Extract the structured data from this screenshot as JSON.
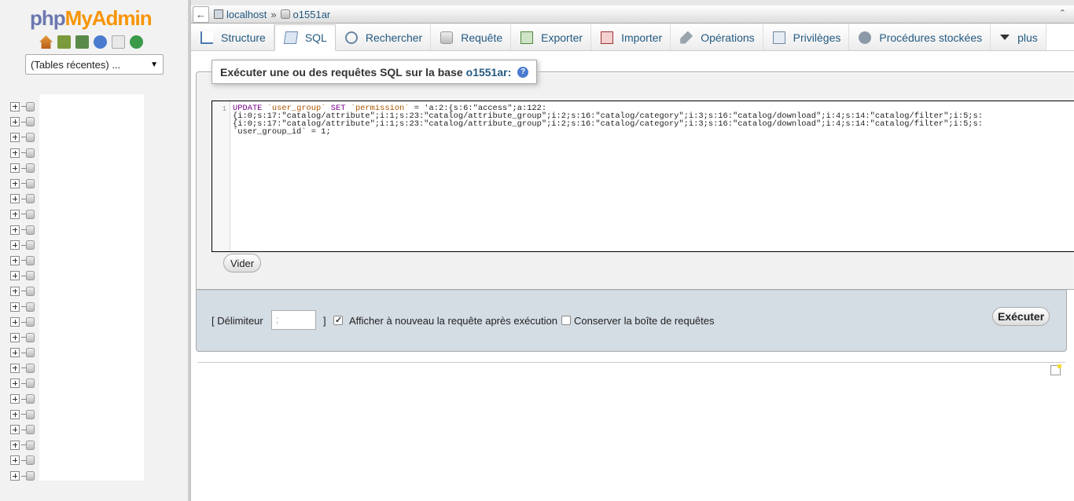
{
  "app": {
    "logo_php": "php",
    "logo_admin": "MyAdmin",
    "recent_tables_select": "(Tables récentes) ...",
    "nav_icons": [
      "home-icon",
      "exit-icon",
      "query-window-icon",
      "help-icon",
      "documentation-icon",
      "reload-icon"
    ]
  },
  "breadcrumb": {
    "server": "localhost",
    "separator": "»",
    "database": "o1551ar"
  },
  "tabs": [
    {
      "label": "Structure",
      "icon": "structure-icon"
    },
    {
      "label": "SQL",
      "icon": "sql-icon",
      "active": true
    },
    {
      "label": "Rechercher",
      "icon": "search-icon"
    },
    {
      "label": "Requête",
      "icon": "query-icon"
    },
    {
      "label": "Exporter",
      "icon": "export-icon"
    },
    {
      "label": "Importer",
      "icon": "import-icon"
    },
    {
      "label": "Opérations",
      "icon": "operations-icon"
    },
    {
      "label": "Privilèges",
      "icon": "privileges-icon"
    },
    {
      "label": "Procédures stockées",
      "icon": "routines-icon"
    },
    {
      "label": "plus",
      "icon": "dropdown-arrow-icon"
    }
  ],
  "sql_panel": {
    "legend_prefix": "Exécuter une ou des requêtes SQL sur la base",
    "legend_db": "o1551ar:",
    "line_number": "1",
    "code": {
      "kw_update": "UPDATE",
      "table": "`user_group`",
      "kw_set": "SET",
      "column": "`permission`",
      "line1_rest": " = 'a:2:{s:6:\"access\";a:122:",
      "line2": "{i:0;s:17:\"catalog/attribute\";i:1;s:23:\"catalog/attribute_group\";i:2;s:16:\"catalog/category\";i:3;s:16:\"catalog/download\";i:4;s:14:\"catalog/filter\";i:5;s:",
      "line3": "{i:0;s:17:\"catalog/attribute\";i:1;s:23:\"catalog/attribute_group\";i:2;s:16:\"catalog/category\";i:3;s:16:\"catalog/download\";i:4;s:14:\"catalog/filter\";i:5;s:",
      "line4": "`user_group_id` = 1;"
    },
    "clear_button": "Vider"
  },
  "options": {
    "delimiter_label_open": "[ Délimiteur",
    "delimiter_value": ";",
    "delimiter_label_close": "]",
    "show_again_label": "Afficher à nouveau la requête après exécution",
    "show_again_checked": true,
    "retain_box_label": "Conserver la boîte de requêtes",
    "retain_box_checked": false,
    "execute_button": "Exécuter"
  },
  "tree_row_count": 25
}
